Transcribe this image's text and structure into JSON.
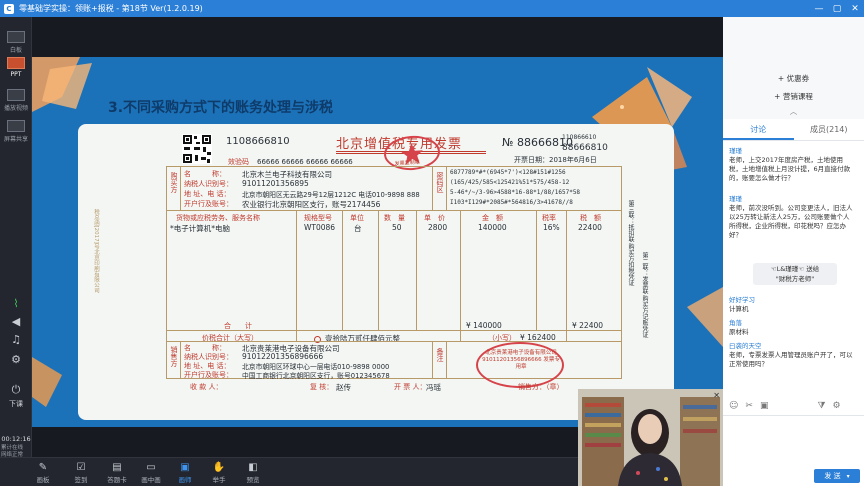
{
  "titlebar": {
    "title": "零基础学实操：领账+报税 - 第18节 Ver(1.2.0.19)",
    "logo": "C",
    "min": "—",
    "max": "▢",
    "close": "✕"
  },
  "left_tools": [
    {
      "name": "tool-whiteboard",
      "label": "白板",
      "icon": "board-icon"
    },
    {
      "name": "tool-ppt",
      "label": "PPT",
      "icon": "ppt-icon"
    },
    {
      "name": "tool-video",
      "label": "播放视频",
      "icon": "video-icon"
    },
    {
      "name": "tool-screen",
      "label": "屏幕共享",
      "icon": "screen-icon"
    },
    {
      "name": "tool-signal",
      "label": "",
      "icon": "signal-icon"
    },
    {
      "name": "tool-volume",
      "label": "",
      "icon": "volume-icon"
    },
    {
      "name": "tool-music",
      "label": "",
      "icon": "music-icon"
    },
    {
      "name": "tool-settings",
      "label": "",
      "icon": "gear-icon"
    },
    {
      "name": "tool-end",
      "label": "下课",
      "icon": "power-icon"
    }
  ],
  "timer": "00:12:16",
  "side_info": [
    "累计在线",
    "网络正常"
  ],
  "slide": {
    "title": "3.不同采购方式下的账务处理与涉税",
    "invoice": {
      "code_left": "1108666810",
      "heading": "北京增值税专用发票",
      "no_label": "№",
      "no_value": "88666810",
      "code_right1": "110866610",
      "code_right2": "88666810",
      "date_label": "开票日期：",
      "date_value": "2018年6月6日",
      "check_label": "效验码",
      "check_value": "66666 66666 66666 66666",
      "buyer_side": "购买方",
      "buyer_name_label": "名　　　称：",
      "buyer_name": "北京木兰电子科技有限公司",
      "buyer_tax_label": "纳税人识别号：",
      "buyer_tax": "91011201356895",
      "buyer_addr_label": "地 址、电 话：",
      "buyer_addr": "北京市朝阳区无云路29号12层1212C 电话010-9898 888",
      "buyer_bank_label": "开户行及账号：",
      "buyer_bank": "农业银行北京朝阳区支行，账号2174456",
      "pw_label": "密码区",
      "pw_lines": [
        "6877789*#*(6945*7')<128#151#1256",
        "(165/425/585<125421%51*575/458-12",
        "5-46*/~/3-96>4588*16-88*1/88/1657*58",
        "I103*I129#*2085#*564816/3>41678//8"
      ],
      "col_goods": "货物或应税劳务、服务名称",
      "col_spec": "规格型号",
      "col_unit": "单位",
      "col_qty": "数　量",
      "col_price": "单　价",
      "col_amount": "金　额",
      "col_rate": "税率",
      "col_tax": "税　额",
      "item_name": "*电子计算机*电脑",
      "item_spec": "WT0086",
      "item_unit": "台",
      "item_qty": "50",
      "item_price": "2800",
      "item_amount": "140000",
      "item_rate": "16%",
      "item_tax": "22400",
      "total_label": "合　　计",
      "total_amount": "¥ 140000",
      "total_tax": "¥ 22400",
      "sum_label": "价税合计（大写）",
      "sum_words": "壹拾陆万贰仟肆佰元整",
      "sum_small_label": "（小写）",
      "sum_small": "¥ 162400",
      "seller_side": "销售方",
      "seller_name_label": "名　　　称：",
      "seller_name": "北京贵莱港电子设备有限公司",
      "seller_tax_label": "纳税人识别号：",
      "seller_tax": "91012201356896666",
      "seller_addr_label": "地 址、电 话：",
      "seller_addr": "北京市朝阳区环球中心一层电话010-9898 0000",
      "seller_bank_label": "开户行及账号：",
      "seller_bank": "中国工商银行北京朝阳区支行，账号012345678",
      "note_label": "备注",
      "payee_label": "收 款 人：",
      "review_label": "复 核：",
      "review_value": "赵传",
      "drawer_label": "开 票 人：",
      "drawer_value": "冯瑶",
      "seller_stamp_label": "销售方：（章）",
      "side_text1": "第三联：抵扣联 购买方扣税凭证",
      "side_text2": "第二联：发票联 购买方记账凭证",
      "left_side_text": "税总函[2017]号北京印刷有限公司",
      "stamp_buyer": "发票监制章",
      "stamp_seller": "北京贵莱港电子设备有限公司 91011201356896666 发票专用章"
    }
  },
  "right_panel": {
    "btn_coupon": "+ 优惠券",
    "btn_course": "+ 营销课程",
    "collapse": "︿",
    "tab_chat": "讨论",
    "tab_members": "成员(214)",
    "messages": [
      {
        "who": "瑾瑾",
        "text": "老师，上交2017年度房产税，土地使用税，土地增值税上月没计提，6月直接付款的，账要怎么做才行？"
      },
      {
        "who": "瑾瑾",
        "text": "老师，前次没听到。公司变更法人，旧法人以25万转让新法人25万，公司账要做个人所得税，企业所得税，印花税吗？应怎办好？"
      },
      {
        "who": "好好学习",
        "text": "计算机"
      },
      {
        "who": "角落",
        "text": "原材料"
      },
      {
        "who": "曰袭的天空",
        "text": "老师，专票发票人用管理员账户开了，可以正常使用吗？"
      }
    ],
    "gift_from": "☜L&瑾瑾☜ 送给",
    "gift_to": "\"财税方老师\"",
    "send": "发 送",
    "send_dd": "▾"
  },
  "bottom_bar": [
    {
      "name": "btn-pen",
      "label": "画板",
      "icon": "brush-icon"
    },
    {
      "name": "btn-sign",
      "label": "签到",
      "icon": "checkin-icon"
    },
    {
      "name": "btn-answer",
      "label": "答题卡",
      "icon": "quiz-icon"
    },
    {
      "name": "btn-pip",
      "label": "画中画",
      "icon": "pip-icon"
    },
    {
      "name": "btn-mode",
      "label": "画师",
      "icon": "camera-icon"
    },
    {
      "name": "btn-hand",
      "label": "举手",
      "icon": "hand-icon"
    },
    {
      "name": "btn-preview",
      "label": "预览",
      "icon": "preview-icon"
    }
  ],
  "colors": {
    "accent": "#2c7fd6",
    "slide_bg": "#1c72b8",
    "orange": "#f29b4a",
    "seal_red": "#d7434a"
  }
}
